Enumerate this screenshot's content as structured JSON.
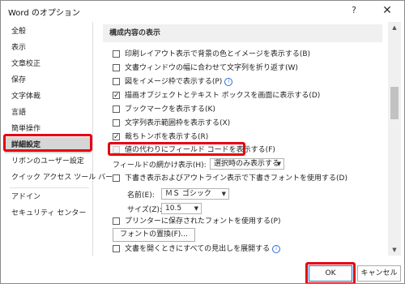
{
  "window": {
    "title": "Word のオプション",
    "help_glyph": "?",
    "close_glyph": "✕"
  },
  "sidebar": {
    "items": [
      {
        "label": "全般"
      },
      {
        "label": "表示"
      },
      {
        "label": "文章校正"
      },
      {
        "label": "保存"
      },
      {
        "label": "文字体裁"
      },
      {
        "label": "言語"
      },
      {
        "label": "簡単操作"
      },
      {
        "label": "詳細設定",
        "selected": true
      },
      {
        "label": "リボンのユーザー設定"
      },
      {
        "label": "クイック アクセス ツール バー"
      },
      {
        "label": "アドイン"
      },
      {
        "label": "セキュリティ センター"
      }
    ]
  },
  "content": {
    "section_title": "構成内容の表示",
    "options": [
      {
        "label": "印刷レイアウト表示で背景の色とイメージを表示する(B)",
        "checked": false
      },
      {
        "label": "文書ウィンドウの幅に合わせて文字列を折り返す(W)",
        "checked": false
      },
      {
        "label": "図をイメージ枠で表示する(P)",
        "checked": false,
        "info": "i"
      },
      {
        "label": "描画オブジェクトとテキスト ボックスを画面に表示する(D)",
        "checked": true
      },
      {
        "label": "ブックマークを表示する(K)",
        "checked": false
      },
      {
        "label": "文字列表示範囲枠を表示する(X)",
        "checked": false
      },
      {
        "label": "裁ちトンボを表示する(R)",
        "checked": true
      },
      {
        "label": "値の代わりにフィールド コードを表示する(F)",
        "checked": false,
        "disabled": true
      }
    ],
    "field_shading": {
      "label": "フィールドの網かけ表示(H):",
      "value": "選択時のみ表示する"
    },
    "draft_font": {
      "label": "下書き表示およびアウトライン表示で下書きフォントを使用する(D)",
      "checked": false
    },
    "font_name": {
      "label": "名前(E):",
      "value": "ＭＳ ゴシック"
    },
    "font_size": {
      "label": "サイズ(Z):",
      "value": "10.5"
    },
    "printer_fonts": {
      "label": "プリンターに保存されたフォントを使用する(P)",
      "checked": false
    },
    "font_substitution_button": "フォントの置換(F)...",
    "expand_headings": {
      "label": "文書を開くときにすべての見出しを展開する",
      "checked": false,
      "info": "i"
    }
  },
  "scrollbar": {
    "up": "▲",
    "down": "▼"
  },
  "footer": {
    "ok_label": "OK",
    "cancel_label": "キャンセル"
  },
  "colors": {
    "highlight": "#e60012",
    "selected_bg": "#d6d6d6",
    "section_bg": "#f0f0f0"
  }
}
